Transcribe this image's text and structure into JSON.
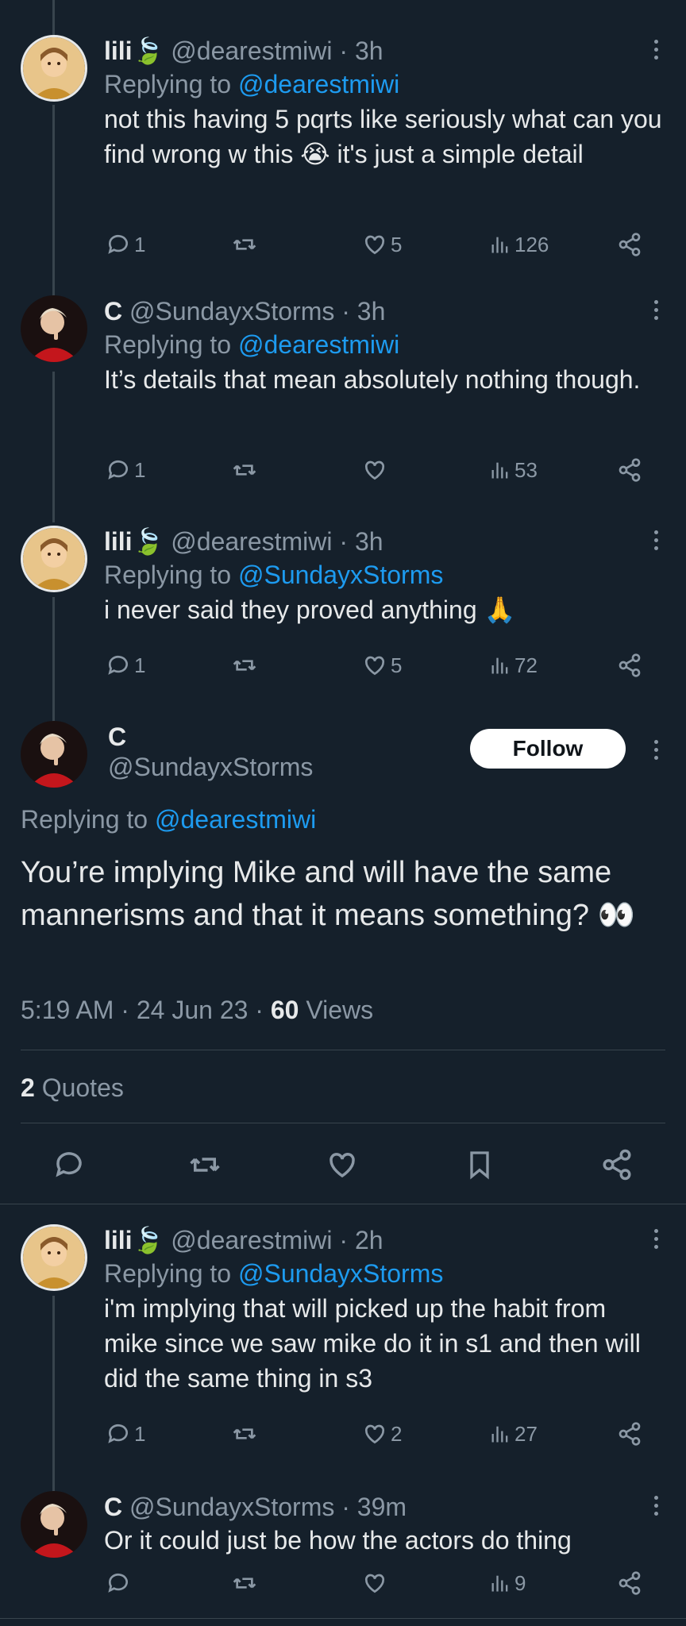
{
  "replies_top": [
    {
      "name": "lili",
      "handle": "@dearestmiwi",
      "time": "· 3h",
      "replying_prefix": "Replying to",
      "replying_to": "@dearestmiwi",
      "text": "not this having 5 pqrts like seriously what can you find wrong w this 😭 it's just a simple detail",
      "replies": "1",
      "retweets": "",
      "likes": "5",
      "views": "126"
    },
    {
      "name": "C",
      "handle": "@SundayxStorms",
      "time": "· 3h",
      "replying_prefix": "Replying to",
      "replying_to": "@dearestmiwi",
      "text": "It’s details that mean absolutely nothing though.",
      "replies": "1",
      "retweets": "",
      "likes": "",
      "views": "53"
    },
    {
      "name": "lili",
      "handle": "@dearestmiwi",
      "time": "· 3h",
      "replying_prefix": "Replying to",
      "replying_to": "@SundayxStorms",
      "text": "i never said they proved anything 🙏",
      "replies": "1",
      "retweets": "",
      "likes": "5",
      "views": "72"
    }
  ],
  "main_tweet": {
    "name": "C",
    "handle": "@SundayxStorms",
    "follow_label": "Follow",
    "replying_prefix": "Replying to",
    "replying_to": "@dearestmiwi",
    "text": "You’re implying Mike and will have the same mannerisms and that it means something? 👀",
    "time": "5:19 AM",
    "date": "24 Jun 23",
    "views_count": "60",
    "views_label": "Views",
    "quotes_count": "2",
    "quotes_label": "Quotes"
  },
  "replies_bottom": [
    {
      "name": "lili",
      "handle": "@dearestmiwi",
      "time": "· 2h",
      "replying_prefix": "Replying to",
      "replying_to": "@SundayxStorms",
      "text": "i'm implying that will picked up the habit from mike since we saw mike do it in s1 and then will did the same thing in s3",
      "replies": "1",
      "retweets": "",
      "likes": "2",
      "views": "27"
    },
    {
      "name": "C",
      "handle": "@SundayxStorms",
      "time": "· 39m",
      "text": "Or it could just be how the actors do thing",
      "replies": "",
      "retweets": "",
      "likes": "",
      "views": "9"
    }
  ],
  "colors": {
    "background": "#15202b",
    "link": "#1d9bf0",
    "muted": "#8b98a5",
    "text": "#e7e9ea"
  }
}
